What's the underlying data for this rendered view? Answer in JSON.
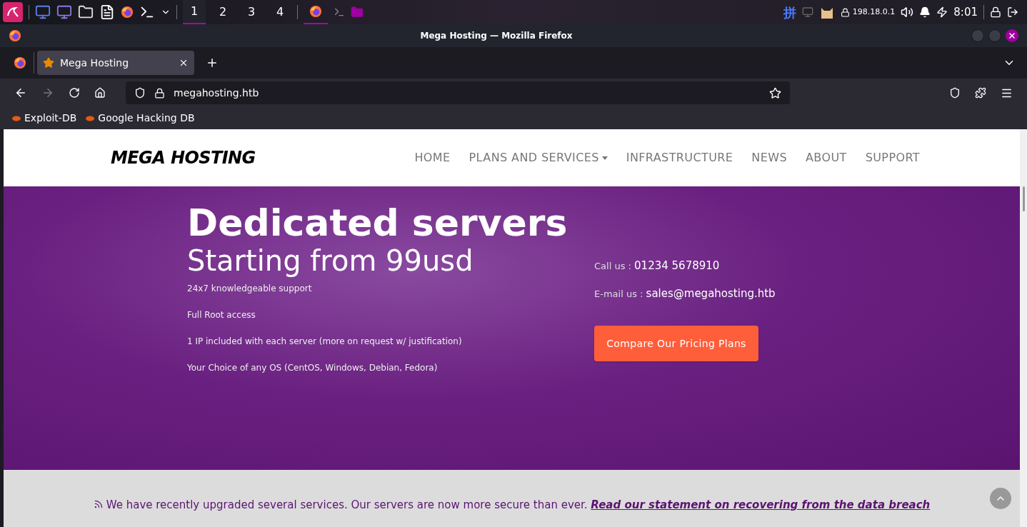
{
  "taskbar": {
    "workspaces": [
      {
        "label": "1",
        "selected": true
      },
      {
        "label": "2",
        "selected": false
      },
      {
        "label": "3",
        "selected": false
      },
      {
        "label": "4",
        "selected": false
      }
    ],
    "input_method": "拼",
    "ip": "198.18.0.1",
    "clock": "8:01"
  },
  "window": {
    "title": "Mega Hosting — Mozilla Firefox"
  },
  "tabs": [
    {
      "label": "Mega Hosting",
      "selected": true
    }
  ],
  "address_bar": {
    "url": "megahosting.htb"
  },
  "bookmarks": [
    "Exploit-DB",
    "Google Hacking DB"
  ],
  "site": {
    "logo": "MEGA HOSTING",
    "nav": [
      {
        "label": "HOME",
        "dropdown": false
      },
      {
        "label": "PLANS AND SERVICES",
        "dropdown": true
      },
      {
        "label": "INFRASTRUCTURE",
        "dropdown": false
      },
      {
        "label": "NEWS",
        "dropdown": false
      },
      {
        "label": "ABOUT",
        "dropdown": false
      },
      {
        "label": "SUPPORT",
        "dropdown": false
      }
    ],
    "hero": {
      "title": "Dedicated servers",
      "subtitle": "Starting from 99usd",
      "features": [
        "24x7 knowledgeable support",
        "Full Root access",
        "1 IP included with each server (more on request w/ justification)",
        "Your Choice of any OS (CentOS, Windows, Debian, Fedora)"
      ],
      "contacts": [
        {
          "label": "Call us : ",
          "value": "01234 5678910"
        },
        {
          "label": "E-mail us : ",
          "value": "sales@megahosting.htb"
        }
      ],
      "button": "Compare Our Pricing Plans"
    },
    "notice": {
      "text": "We have recently upgraded several services. Our servers are now more secure than ever.",
      "link": "Read our statement on recovering from the data breach"
    }
  }
}
